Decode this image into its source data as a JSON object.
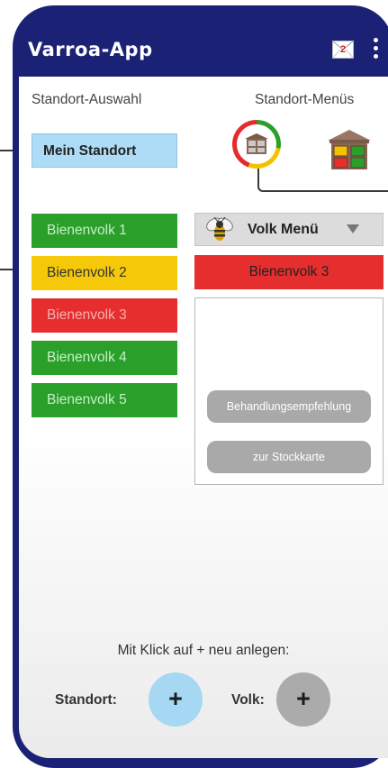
{
  "app": {
    "title": "Varroa-App",
    "notification_count": "2",
    "header_color": "#1b2275"
  },
  "labels": {
    "standort_auswahl": "Standort-Auswahl",
    "standort_menus": "Standort-Menüs"
  },
  "standort": {
    "selected": "Mein Standort",
    "color": "#aedcf6"
  },
  "colonies": [
    {
      "name": "Bienenvolk 1",
      "color": "#2aa02a",
      "status": "green"
    },
    {
      "name": "Bienenvolk 2",
      "color": "#f5c90a",
      "status": "yellow"
    },
    {
      "name": "Bienenvolk 3",
      "color": "#e62e2e",
      "status": "red"
    },
    {
      "name": "Bienenvolk 4",
      "color": "#2aa02a",
      "status": "green"
    },
    {
      "name": "Bienenvolk 5",
      "color": "#2aa02a",
      "status": "green"
    }
  ],
  "volk_menu": {
    "label": "Volk Menü",
    "icon": "bee-icon",
    "selected_colony": "Bienenvolk 3",
    "buttons": {
      "behandlung": "Behandlungsempfehlung",
      "stockkarte": "zur Stockkarte"
    }
  },
  "footer": {
    "hint": "Mit Klick auf + neu anlegen:",
    "standort_label": "Standort:",
    "volk_label": "Volk:",
    "plus": "+"
  }
}
